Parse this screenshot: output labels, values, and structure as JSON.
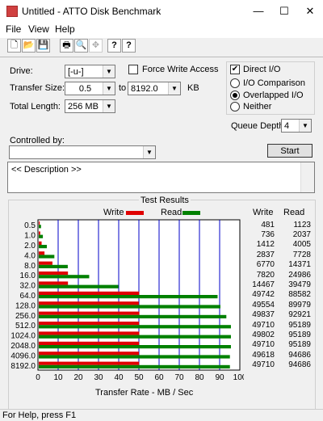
{
  "window": {
    "title": "Untitled - ATTO Disk Benchmark",
    "minimize": "—",
    "maximize": "☐",
    "close": "✕"
  },
  "menu": [
    "File",
    "View",
    "Help"
  ],
  "toolbar": {
    "new": "🗋",
    "open": "📂",
    "save": "💾",
    "print": "🖶",
    "preview": "🔍",
    "move": "✥",
    "help": "?",
    "context_help": "?"
  },
  "form": {
    "drive_label": "Drive:",
    "drive_value": "[-u-]",
    "force_write_label": "Force Write Access",
    "force_write_checked": false,
    "direct_io_label": "Direct I/O",
    "direct_io_checked": true,
    "transfer_size_label": "Transfer Size:",
    "transfer_from": "0.5",
    "to_label": "to",
    "transfer_to": "8192.0",
    "kb_label": "KB",
    "total_length_label": "Total Length:",
    "total_length": "256 MB",
    "io_comparison_label": "I/O Comparison",
    "overlapped_io_label": "Overlapped I/O",
    "neither_label": "Neither",
    "io_mode": "overlapped",
    "queue_depth_label": "Queue Depth:",
    "queue_depth": "4",
    "controlled_by_label": "Controlled by:",
    "controlled_by_value": "",
    "start_label": "Start",
    "description": "<< Description >>"
  },
  "results": {
    "title": "Test Results",
    "write_legend": "Write",
    "read_legend": "Read",
    "write_header": "Write",
    "read_header": "Read",
    "write_color": "#e00000",
    "read_color": "#008000",
    "x_label": "Transfer Rate - MB / Sec"
  },
  "chart_data": {
    "type": "bar",
    "orientation": "horizontal",
    "categories": [
      "0.5",
      "1.0",
      "2.0",
      "4.0",
      "8.0",
      "16.0",
      "32.0",
      "64.0",
      "128.0",
      "256.0",
      "512.0",
      "1024.0",
      "2048.0",
      "4096.0",
      "8192.0"
    ],
    "series": [
      {
        "name": "Write",
        "values": [
          481,
          736,
          1412,
          2837,
          6770,
          14467,
          14467,
          49742,
          49554,
          49837,
          49710,
          49802,
          49710,
          49618,
          49710
        ]
      },
      {
        "name": "Read",
        "values": [
          1123,
          2037,
          4005,
          7728,
          14371,
          24986,
          39479,
          88582,
          89979,
          92921,
          95189,
          95189,
          95189,
          94686,
          94686
        ]
      }
    ],
    "x_ticks": [
      "0",
      "10",
      "20",
      "30",
      "40",
      "50",
      "60",
      "70",
      "80",
      "90",
      "100"
    ],
    "xlim": [
      0,
      100
    ],
    "xlabel": "Transfer Rate - MB / Sec",
    "legend": "top",
    "grid": true
  },
  "table": {
    "write": [
      "481",
      "736",
      "1412",
      "2837",
      "6770",
      "7820",
      "14467",
      "49742",
      "49554",
      "49837",
      "49710",
      "49802",
      "49710",
      "49618",
      "49710"
    ],
    "read": [
      "1123",
      "2037",
      "4005",
      "7728",
      "14371",
      "24986",
      "39479",
      "88582",
      "89979",
      "92921",
      "95189",
      "95189",
      "95189",
      "94686",
      "94686"
    ]
  },
  "status": "For Help, press F1"
}
